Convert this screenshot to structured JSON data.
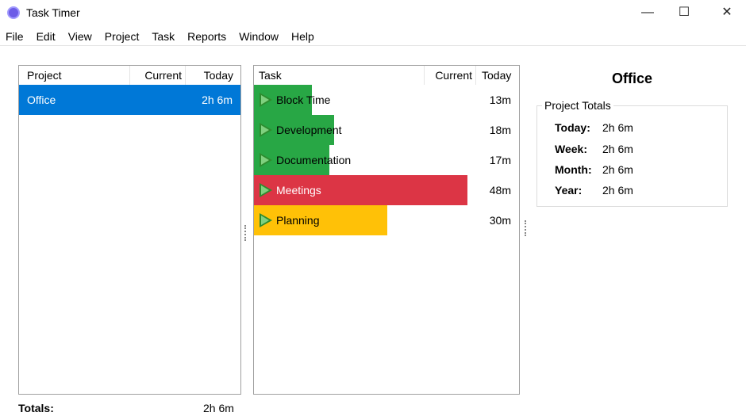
{
  "window": {
    "title": "Task Timer",
    "minimize": "—",
    "maximize": "☐",
    "close": "✕"
  },
  "menu": [
    "File",
    "Edit",
    "View",
    "Project",
    "Task",
    "Reports",
    "Window",
    "Help"
  ],
  "projects": {
    "headers": {
      "name": "Project",
      "current": "Current",
      "today": "Today"
    },
    "rows": [
      {
        "name": "Office",
        "current": "",
        "today": "2h 6m",
        "selected": true
      }
    ],
    "totals_label": "Totals:",
    "totals_value": "2h 6m",
    "selection_color": "#0078d7"
  },
  "tasks": {
    "headers": {
      "name": "Task",
      "current": "Current",
      "today": "Today"
    },
    "rows": [
      {
        "name": "Block Time",
        "current": "",
        "today": "13m",
        "minutes": 13,
        "color": "#28a745"
      },
      {
        "name": "Development",
        "current": "",
        "today": "18m",
        "minutes": 18,
        "color": "#28a745"
      },
      {
        "name": "Documentation",
        "current": "",
        "today": "17m",
        "minutes": 17,
        "color": "#28a745"
      },
      {
        "name": "Meetings",
        "current": "",
        "today": "48m",
        "minutes": 48,
        "color": "#dc3545",
        "text_color": "#ffffff"
      },
      {
        "name": "Planning",
        "current": "",
        "today": "30m",
        "minutes": 30,
        "color": "#ffc107"
      }
    ]
  },
  "detail": {
    "title": "Office",
    "group": "Project Totals",
    "totals": [
      {
        "label": "Today:",
        "value": "2h 6m"
      },
      {
        "label": "Week:",
        "value": "2h 6m"
      },
      {
        "label": "Month:",
        "value": "2h 6m"
      },
      {
        "label": "Year:",
        "value": "2h 6m"
      }
    ]
  }
}
